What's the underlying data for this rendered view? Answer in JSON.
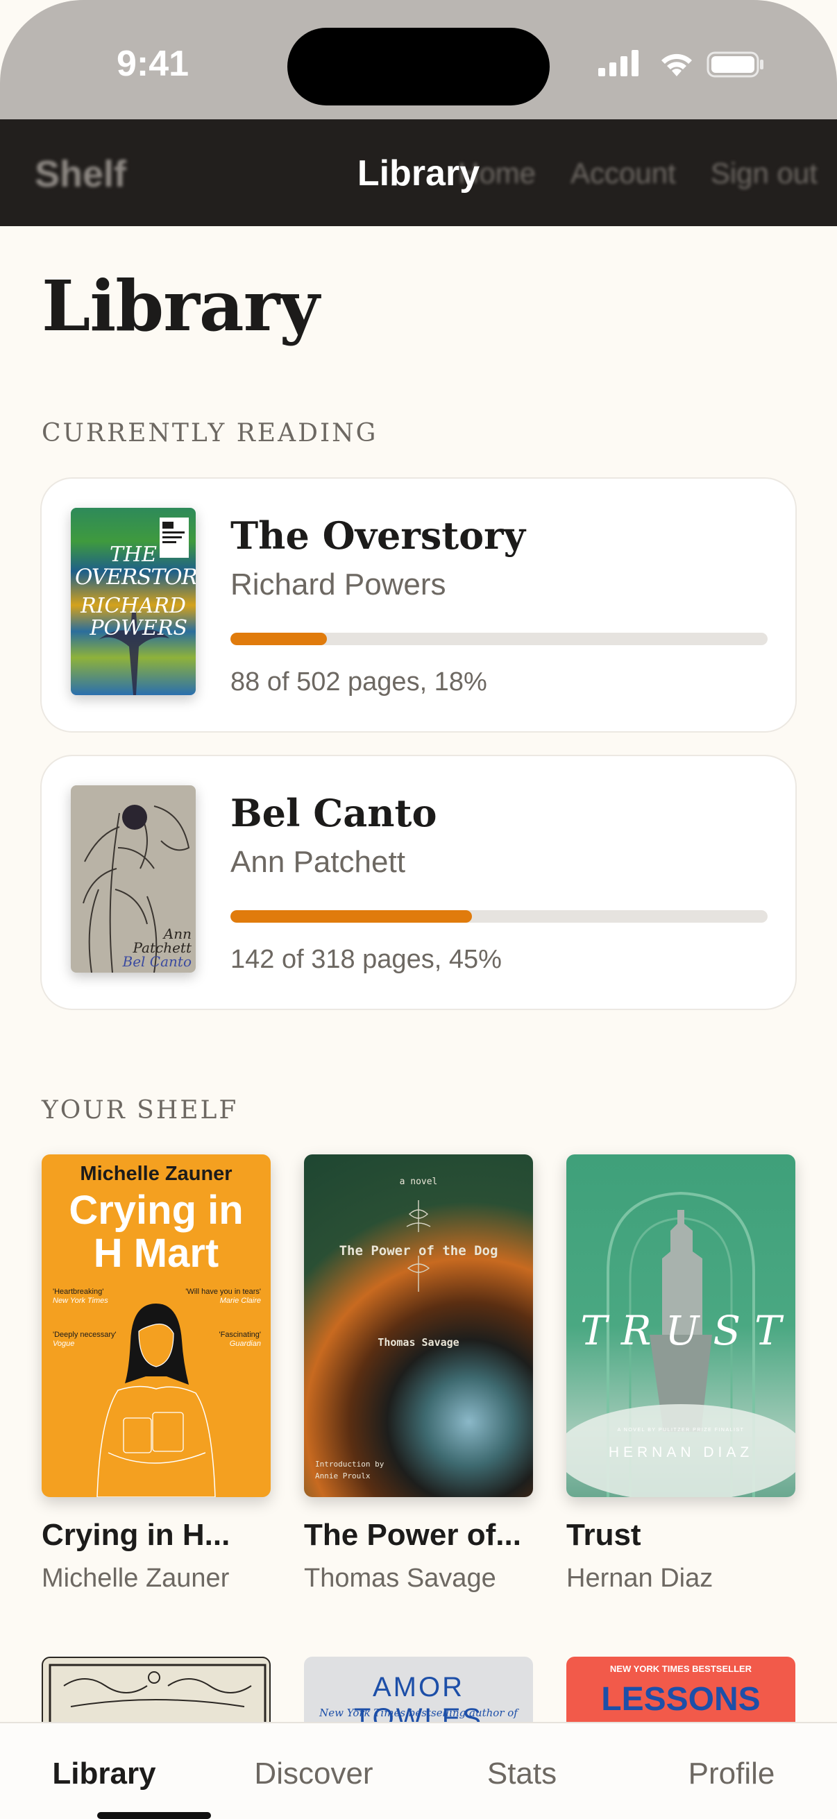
{
  "status": {
    "time": "9:41"
  },
  "web_nav": {
    "brand": "Shelf",
    "title": "Library",
    "links": [
      "Home",
      "Account",
      "Sign out"
    ]
  },
  "page": {
    "title": "Library"
  },
  "currently_reading": {
    "heading": "CURRENTLY READING",
    "books": [
      {
        "title": "The Overstory",
        "author": "Richard Powers",
        "progress": 0.18,
        "progress_text": "88 of 502 pages, 18%",
        "cover_lines": [
          "THE",
          "OVERSTORY",
          "RICHARD",
          "POWERS"
        ]
      },
      {
        "title": "Bel Canto",
        "author": "Ann Patchett",
        "progress": 0.45,
        "progress_text": "142 of 318 pages, 45%",
        "cover_lines": [
          "Ann",
          "Patchett",
          "Bel Canto"
        ]
      }
    ]
  },
  "shelf": {
    "heading": "YOUR SHELF",
    "books": [
      {
        "title": "Crying in H...",
        "author": "Michelle Zauner",
        "cover": {
          "author": "Michelle Zauner",
          "title_line1": "Crying in",
          "title_line2": "H Mart",
          "quotes": [
            {
              "q": "'Heartbreaking'",
              "src": "New York Times"
            },
            {
              "q": "'Will have you in tears'",
              "src": "Marie Claire"
            },
            {
              "q": "'Deeply necessary'",
              "src": "Vogue"
            },
            {
              "q": "'Fascinating'",
              "src": "Guardian"
            }
          ]
        }
      },
      {
        "title": "The Power of...",
        "author": "Thomas Savage",
        "cover": {
          "kicker": "a novel",
          "title": "The Power of the Dog",
          "author": "Thomas Savage",
          "intro_line1": "Introduction by",
          "intro_line2": "Annie Proulx"
        }
      },
      {
        "title": "Trust",
        "author": "Hernan Diaz",
        "cover": {
          "title": "TRUST",
          "tagline": "A NOVEL BY PULITZER PRIZE FINALIST",
          "author": "HERNAN DIAZ"
        }
      }
    ],
    "next_row": [
      {
        "cover_text": ""
      },
      {
        "cover_text": "AMOR TOWLES",
        "sub": "New York Times bestselling author of"
      },
      {
        "cover_text": "LESSONS",
        "sub": "NEW YORK TIMES BESTSELLER"
      }
    ]
  },
  "tabs": [
    "Library",
    "Discover",
    "Stats",
    "Profile"
  ],
  "colors": {
    "accent": "#e07b0c",
    "background": "#fdfaf4",
    "nav": "#221f1d"
  }
}
